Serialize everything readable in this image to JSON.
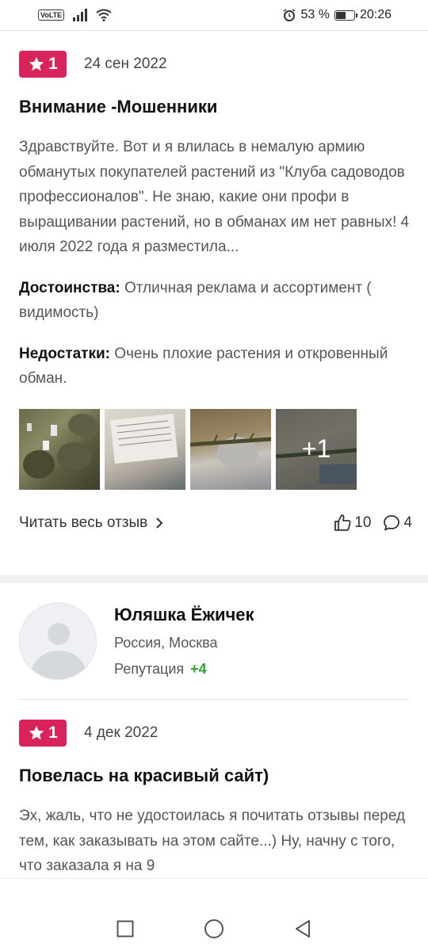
{
  "statusbar": {
    "volte": "VoLTE",
    "battery_percent": "53 %",
    "time": "20:26"
  },
  "reviews": [
    {
      "rating": "1",
      "date": "24 сен 2022",
      "title": "Внимание -Мошенники",
      "text": "Здравствуйте. Вот и я влилась в немалую армию обманутых покупателей растений из \"Клуба садоводов профессионалов\". Не знаю, какие они профи в выращивании растений, но в обманах им нет равных! 4 июля 2022 года я разместила...",
      "pros_label": "Достоинства:",
      "pros": "Отличная реклама и ассортимент ( видимость)",
      "cons_label": "Недостатки:",
      "cons": "Очень плохие растения и откровенный обман.",
      "more_photos": "+1",
      "read_all": "Читать весь отзыв",
      "likes": "10",
      "comments": "4"
    },
    {
      "rating": "1",
      "date": "4 дек 2022",
      "title": "Повелась на красивый сайт)",
      "text": "Эх, жаль, что не удостоилась я почитать отзывы перед тем, как заказывать на этом сайте...) Ну, начну с того, что заказала я на 9"
    }
  ],
  "author": {
    "name": "Юляшка Ёжичек",
    "location": "Россия, Москва",
    "reputation_label": "Репутация",
    "reputation_value": "+4"
  },
  "colors": {
    "badge": "#d8245a",
    "reputation": "#2fa02f"
  }
}
